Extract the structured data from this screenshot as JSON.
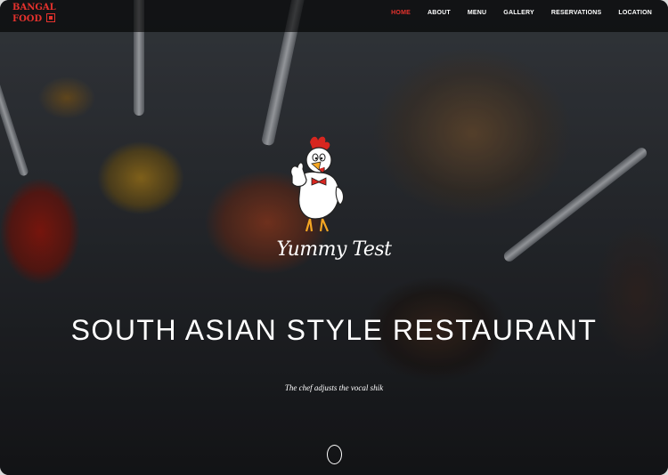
{
  "brand": {
    "line1": "BANGAL",
    "line2": "FOOD",
    "icon": "square-logo-icon",
    "color": "#e5322d"
  },
  "nav": {
    "items": [
      {
        "label": "HOME",
        "active": true
      },
      {
        "label": "ABOUT",
        "active": false
      },
      {
        "label": "MENU",
        "active": false
      },
      {
        "label": "GALLERY",
        "active": false
      },
      {
        "label": "RESERVATIONS",
        "active": false
      },
      {
        "label": "LOCATION",
        "active": false
      }
    ],
    "active_color": "#e5322d"
  },
  "hero": {
    "logo_icon": "rooster-chef-mascot-icon",
    "logo_text": "Yummy Test",
    "title": "SOUTH ASIAN STYLE RESTAURANT",
    "tagline": "The chef adjusts the vocal shik",
    "scroll_icon": "scroll-down-circle-icon"
  }
}
